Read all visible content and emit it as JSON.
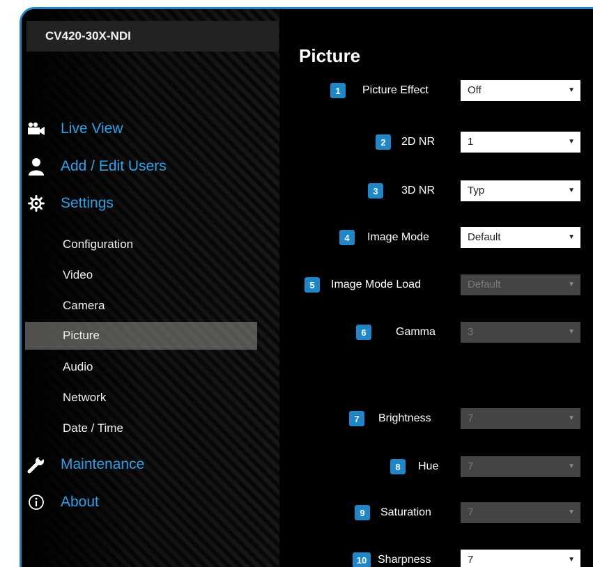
{
  "device_title": "CV420-30X-NDI",
  "nav": {
    "live_view": "Live View",
    "add_edit_users": "Add / Edit Users",
    "settings": "Settings",
    "sub": [
      "Configuration",
      "Video",
      "Camera",
      "Picture",
      "Audio",
      "Network",
      "Date / Time"
    ],
    "active_sub": "Picture",
    "maintenance": "Maintenance",
    "about": "About"
  },
  "page_title": "Picture",
  "fields": [
    {
      "num": "1",
      "label": "Picture Effect",
      "value": "Off",
      "enabled": true
    },
    {
      "num": "2",
      "label": "2D NR",
      "value": "1",
      "enabled": true
    },
    {
      "num": "3",
      "label": "3D NR",
      "value": "Typ",
      "enabled": true
    },
    {
      "num": "4",
      "label": "Image Mode",
      "value": "Default",
      "enabled": true
    },
    {
      "num": "5",
      "label": "Image Mode Load",
      "value": "Default",
      "enabled": false
    },
    {
      "num": "6",
      "label": "Gamma",
      "value": "3",
      "enabled": false
    },
    {
      "num": "7",
      "label": "Brightness",
      "value": "7",
      "enabled": false
    },
    {
      "num": "8",
      "label": "Hue",
      "value": "7",
      "enabled": false
    },
    {
      "num": "9",
      "label": "Saturation",
      "value": "7",
      "enabled": false
    },
    {
      "num": "10",
      "label": "Sharpness",
      "value": "7",
      "enabled": true
    }
  ],
  "colors": {
    "accent": "#1f86c8",
    "nav_link": "#2aa1e8",
    "active_bg": "#8f8a85"
  },
  "icons": [
    "video-camera-icon",
    "user-icon",
    "gear-icon",
    "wrench-icon",
    "info-icon",
    "dropdown-arrow-icon"
  ],
  "dropdown_arrow": "▼"
}
